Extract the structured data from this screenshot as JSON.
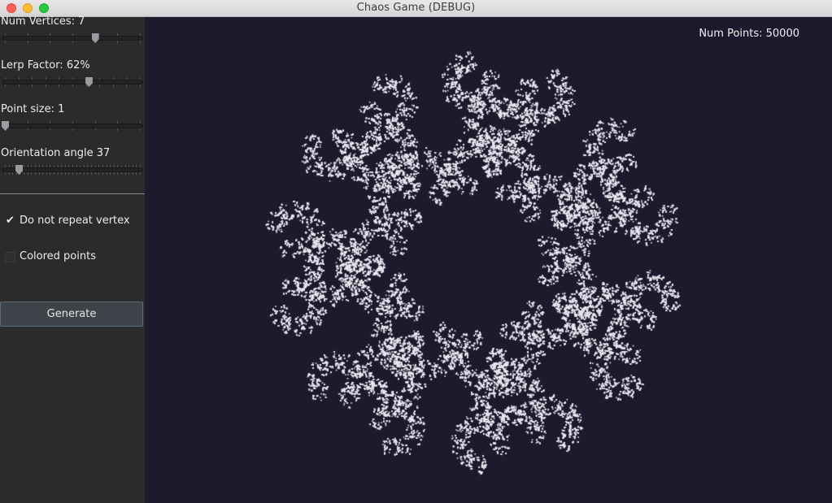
{
  "window": {
    "title": "Chaos Game (DEBUG)"
  },
  "controls": {
    "num_vertices": {
      "label": "Num Vertices: 7",
      "value": 7,
      "min": 3,
      "max": 9
    },
    "lerp_factor": {
      "label": "Lerp Factor: 62%",
      "value": 62,
      "min": 0,
      "max": 100
    },
    "point_size": {
      "label": "Point size: 1",
      "value": 1,
      "min": 1,
      "max": 10
    },
    "orientation_angle": {
      "label": "Orientation angle 37",
      "value": 37,
      "min": 0,
      "max": 360
    },
    "do_not_repeat_vertex": {
      "label": "Do not repeat vertex",
      "checked": true,
      "check_glyph": "✔"
    },
    "colored_points": {
      "label": "Colored points",
      "checked": false
    },
    "generate_label": "Generate"
  },
  "canvas": {
    "num_points_text": "Num Points: 50000",
    "num_points": 50000,
    "background_color": "#1e1a2e",
    "point_color": "#e8e8f0"
  },
  "colors": {
    "sidebar": "#2b2b2d",
    "accent_border": "#5c6a7a"
  }
}
